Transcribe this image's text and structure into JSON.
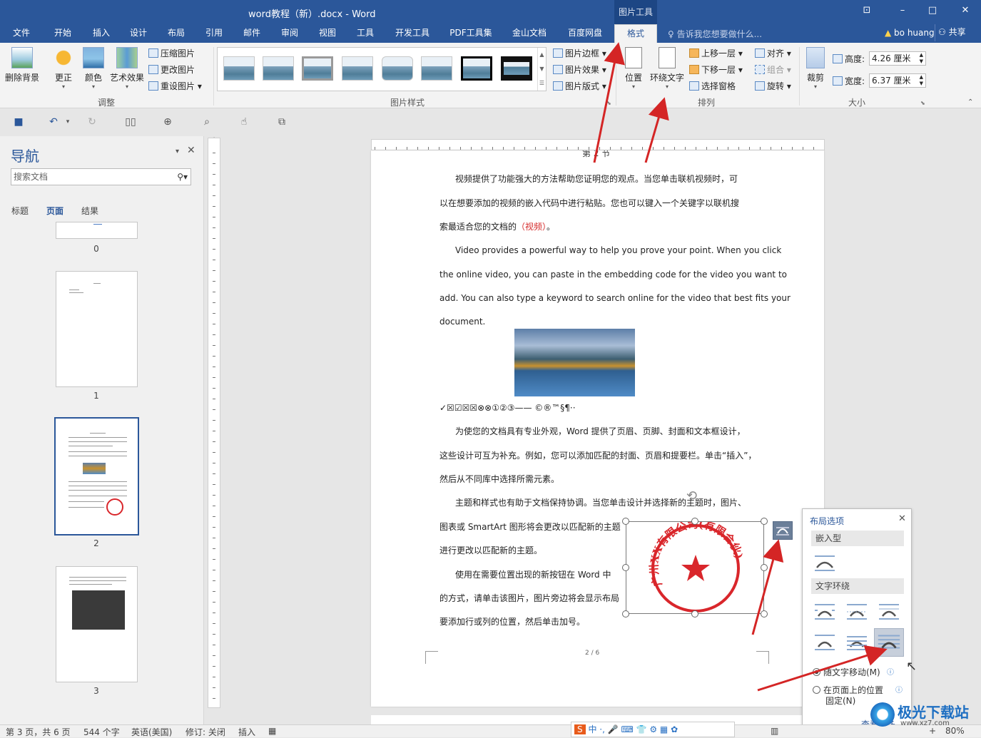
{
  "window": {
    "title": "word教程（新）.docx - Word",
    "context_tab_group": "图片工具",
    "user": "bo huang",
    "share": "共享",
    "tell_me": "告诉我您想要做什么..."
  },
  "tabs": [
    "文件",
    "开始",
    "插入",
    "设计",
    "布局",
    "引用",
    "邮件",
    "审阅",
    "视图",
    "工具",
    "开发工具",
    "PDF工具集",
    "金山文档",
    "百度网盘",
    "格式"
  ],
  "ribbon": {
    "remove_bg": "删除背景",
    "correct": "更正",
    "color": "颜色",
    "art_effect": "艺术效果",
    "compress": "压缩图片",
    "change": "更改图片",
    "reset": "重设图片",
    "adjust_group": "调整",
    "border": "图片边框",
    "effects": "图片效果",
    "layout": "图片版式",
    "styles_group": "图片样式",
    "position": "位置",
    "wrap_text": "环绕文字",
    "bring_forward": "上移一层",
    "send_backward": "下移一层",
    "selection_pane": "选择窗格",
    "align": "对齐",
    "group": "组合",
    "rotate": "旋转",
    "arrange_group": "排列",
    "crop": "裁剪",
    "height_label": "高度:",
    "height_value": "4.26 厘米",
    "width_label": "宽度:",
    "width_value": "6.37 厘米",
    "size_group": "大小"
  },
  "nav": {
    "title": "导航",
    "search_placeholder": "搜索文档",
    "tabs": [
      "标题",
      "页面",
      "结果"
    ],
    "pages": [
      "0",
      "1",
      "2",
      "3"
    ]
  },
  "document": {
    "page_heading": "第 2 节",
    "para1_l1": "视频提供了功能强大的方法帮助您证明您的观点。当您单击联机视频时，可",
    "para1_l2": "以在想要添加的视频的嵌入代码中进行粘贴。您也可以键入一个关键字以联机搜",
    "para1_l3_a": "索最适合您的文档的",
    "para1_l3_b": "（视频）",
    "para1_l3_c": "。",
    "para2_l1": "Video provides a powerful way to help you prove your point. When you click",
    "para2_l2": "the online video, you can paste in the embedding code for the video you want to",
    "para2_l3": "add. You can also type a keyword to search online for the video that best fits your",
    "para2_l4": "document.",
    "symbols": "✓☒☑☒☒⊗⊗①②③——      ©®™§¶··",
    "para3_l1": "为使您的文档具有专业外观，Word 提供了页眉、页脚、封面和文本框设计，",
    "para3_l2": "这些设计可互为补充。例如，您可以添加匹配的封面、页眉和提要栏。单击“插入”，",
    "para3_l3": "然后从不同库中选择所需元素。",
    "para4_l1": "主题和样式也有助于文档保持协调。当您单击设计并选择新的主题时，图片、",
    "para4_l2": "图表或 SmartArt 图形将会更改以匹配新的主题",
    "para4_l3": "进行更改以匹配新的主题。",
    "para5_l1": "使用在需要位置出现的新按钮在 Word 中",
    "para5_l2": "的方式，请单击该图片，图片旁边将会显示布局",
    "para5_l3": "要添加行或列的位置，然后单击加号。",
    "page_number": "2 / 6",
    "stamp_text": "广州XX有限公司(有限合伙)"
  },
  "layout_options": {
    "title": "布局选项",
    "inline_section": "嵌入型",
    "wrap_section": "文字环绕",
    "move_with_text": "随文字移动(M)",
    "fix_position_l1": "在页面上的位置",
    "fix_position_l2": "固定(N)",
    "see_more": "查看更多..."
  },
  "status": {
    "page": "第 3 页，共 6 页",
    "words": "544 个字",
    "language": "英语(美国)",
    "track": "修订: 关闭",
    "mode": "插入",
    "zoom": "80%"
  },
  "watermark": {
    "text": "极光下载站",
    "url": "www.xz7.com"
  },
  "colors": {
    "accent": "#2b579a",
    "stamp": "#d9262b",
    "arrow": "#d42525"
  }
}
